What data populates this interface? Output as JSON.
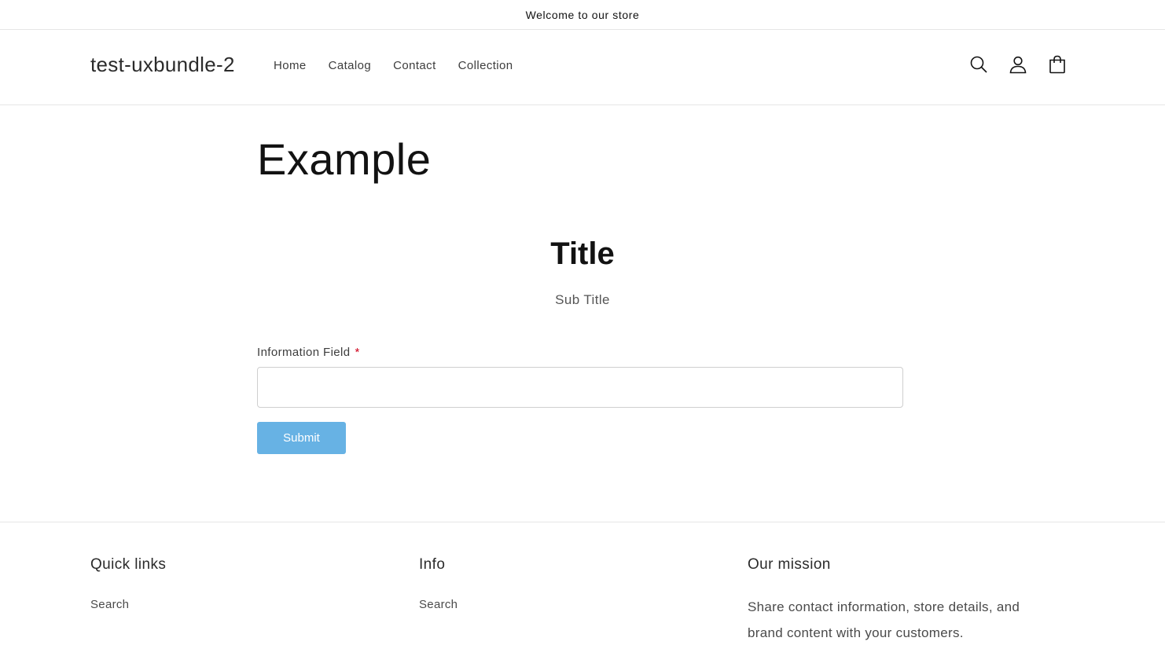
{
  "announcement": {
    "text": "Welcome to our store"
  },
  "header": {
    "logo": "test-uxbundle-2",
    "nav": [
      {
        "label": "Home"
      },
      {
        "label": "Catalog"
      },
      {
        "label": "Contact"
      },
      {
        "label": "Collection"
      }
    ],
    "icons": [
      "search-icon",
      "account-icon",
      "cart-icon"
    ]
  },
  "main": {
    "page_heading": "Example",
    "form": {
      "title": "Title",
      "subtitle": "Sub Title",
      "field_label": "Information Field",
      "required_marker": "*",
      "field_value": "",
      "submit_label": "Submit",
      "submit_color": "#67b2e4",
      "required_color": "#d0021b"
    }
  },
  "footer": {
    "quick_links": {
      "heading": "Quick links",
      "links": [
        {
          "label": "Search"
        }
      ]
    },
    "info": {
      "heading": "Info",
      "links": [
        {
          "label": "Search"
        }
      ]
    },
    "mission": {
      "heading": "Our mission",
      "text": "Share contact information, store details, and brand content with your customers."
    }
  }
}
